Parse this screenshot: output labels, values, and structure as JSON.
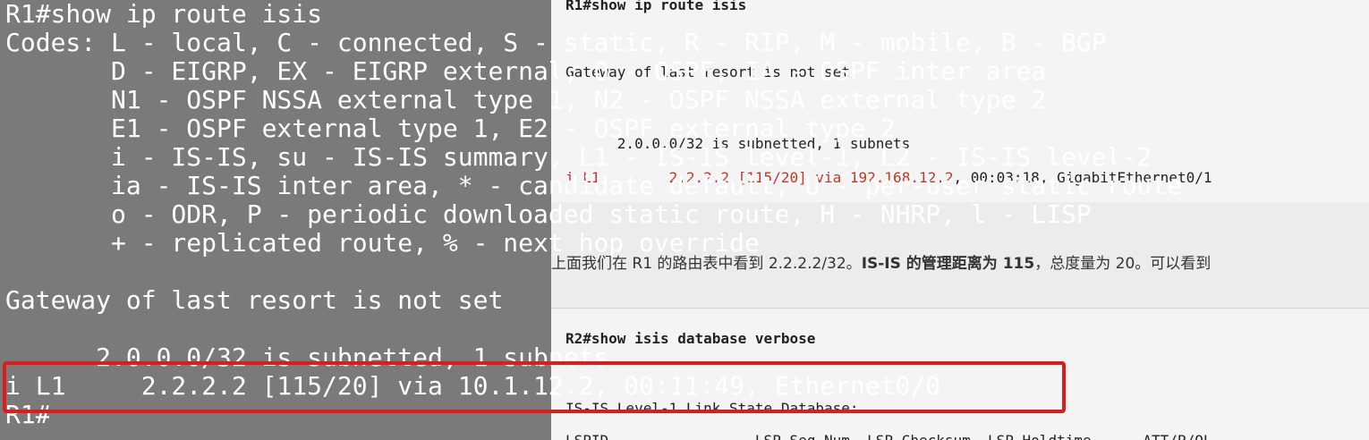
{
  "article": {
    "code_top": {
      "line1": "R1#show ip route isis",
      "line2": "Gateway of last resort is not set",
      "line3": "      2.0.0.0/32 is subnetted, 1 subnets",
      "line4_prefix": "i L1        2.2.2.2 [115/20] via ",
      "line4_via": "192.168.12.2",
      "line4_suffix": ", 00:03:18, GigabitEthernet0/1"
    },
    "paragraph": {
      "before": "上面我们在 R1 的路由表中看到 2.2.2.2/32。",
      "bold": "IS-IS 的管理距离为 115",
      "after": "，总度量为 20。可以看到"
    },
    "code_bottom": {
      "line1": "R2#show isis database verbose",
      "line2": "IS-IS Level-1 Link State Database:",
      "line3": "LSPID                 LSP Seq Num  LSP Checksum  LSP Holdtime      ATT/P/OL"
    }
  },
  "terminal": {
    "lines": [
      "R1#show ip route isis",
      "R1#show ip route isis",
      "Codes: L - local, C - connected, S - static, R - RIP, M - mobile, B - BGP",
      "       D - EIGRP, EX - EIGRP external, O - OSPF, IA - OSPF inter area",
      "       N1 - OSPF NSSA external type 1, N2 - OSPF NSSA external type 2",
      "       E1 - OSPF external type 1, E2 - OSPF external type 2",
      "       i - IS-IS, su - IS-IS summary, L1 - IS-IS level-1, L2 - IS-IS level-2",
      "       ia - IS-IS inter area, * - candidate default, U - per-user static route",
      "       o - ODR, P - periodic downloaded static route, H - NHRP, l - LISP",
      "       + - replicated route, % - next hop override",
      "",
      "Gateway of last resort is not set",
      "",
      "      2.0.0.0/32 is subnetted, 1 subnets",
      "i L1     2.2.2.2 [115/20] via 10.1.12.2, 00:11:49, Ethernet0/0",
      "R1#"
    ]
  },
  "highlight": {
    "color": "#e01b1b"
  }
}
